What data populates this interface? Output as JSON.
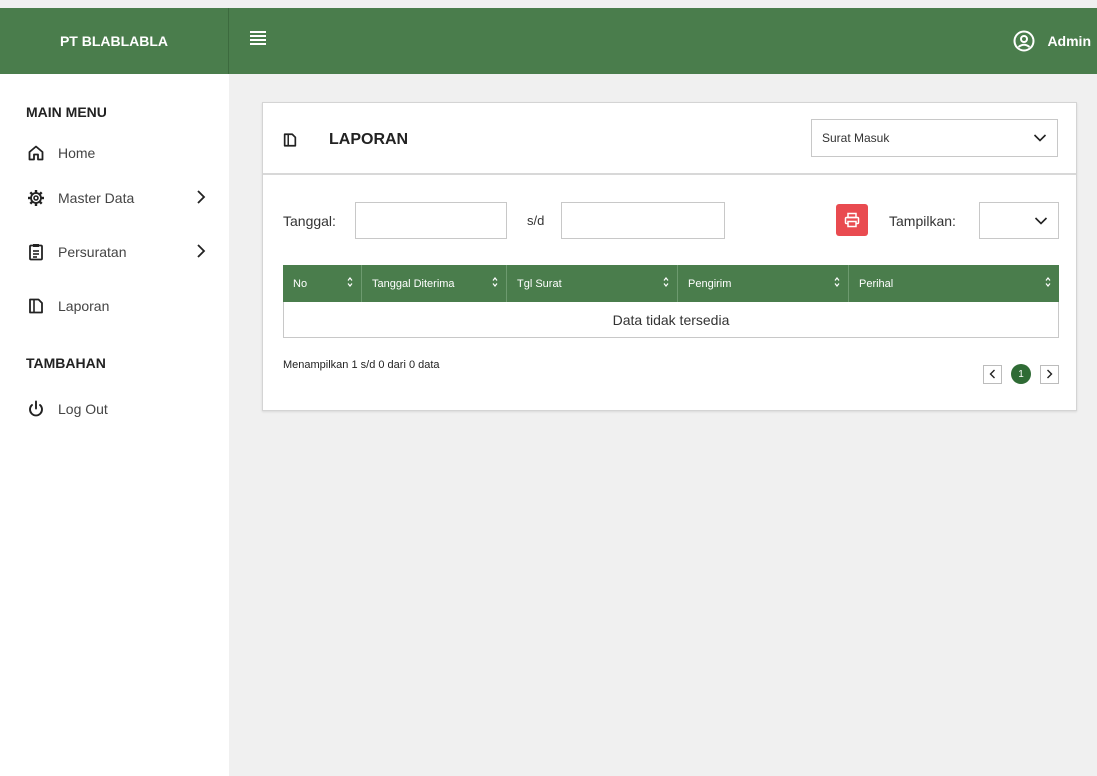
{
  "app": {
    "brand": "PT BLABLABLA",
    "user_name": "Admin"
  },
  "colors": {
    "primary": "#4a7d4c",
    "danger": "#e94b50",
    "page_active": "#2f6b35"
  },
  "sidebar": {
    "main_menu_title": "MAIN MENU",
    "items": [
      {
        "label": "Home",
        "icon": "home-icon",
        "has_submenu": false
      },
      {
        "label": "Master Data",
        "icon": "gear-icon",
        "has_submenu": true
      },
      {
        "label": "Persuratan",
        "icon": "clipboard-icon",
        "has_submenu": true
      },
      {
        "label": "Laporan",
        "icon": "document-icon",
        "has_submenu": false
      }
    ],
    "extra_title": "TAMBAHAN",
    "extra_items": [
      {
        "label": "Log Out",
        "icon": "power-icon"
      }
    ]
  },
  "report": {
    "title": "LAPORAN",
    "type_select_value": "Surat Masuk",
    "date_label": "Tanggal:",
    "date_from_value": "",
    "range_separator": "s/d",
    "date_to_value": "",
    "show_label": "Tampilkan:",
    "show_select_value": ""
  },
  "table": {
    "columns": [
      "No",
      "Tanggal Diterima",
      "Tgl Surat",
      "Pengirim",
      "Perihal"
    ],
    "rows": [],
    "empty_text": "Data tidak tersedia"
  },
  "pagination": {
    "info": "Menampilkan 1 s/d 0 dari 0 data",
    "current_page": "1"
  }
}
